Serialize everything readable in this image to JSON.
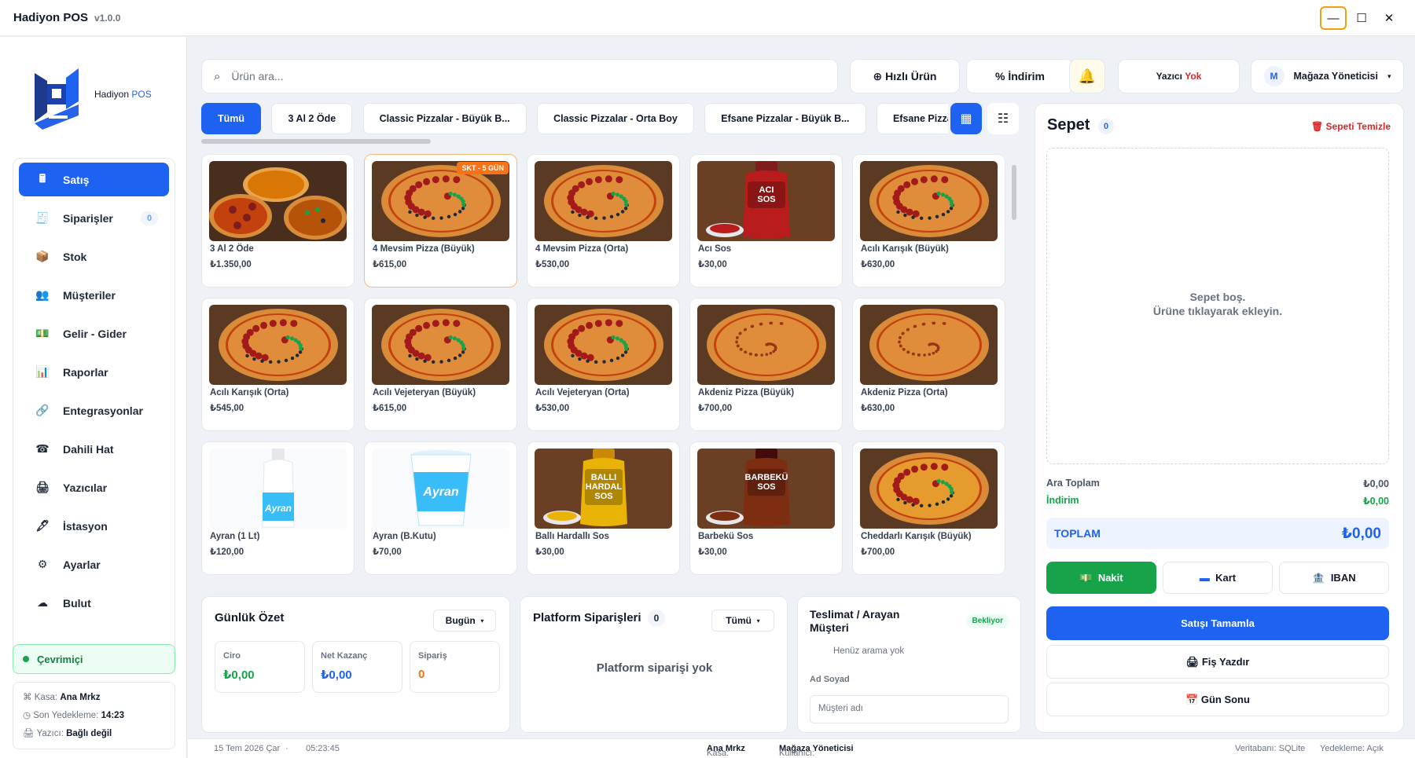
{
  "titlebar": {
    "app_name": "Hadiyon POS",
    "version": "v1.0.0"
  },
  "sidebar": {
    "logo_text": "Hadiyon",
    "logo_text_pos": "POS",
    "items": [
      {
        "label": "Satış",
        "icon": "cash-register-icon",
        "active": true
      },
      {
        "label": "Siparişler",
        "icon": "receipt-icon",
        "count": "0"
      },
      {
        "label": "Stok",
        "icon": "box-icon"
      },
      {
        "label": "Müşteriler",
        "icon": "users-icon"
      },
      {
        "label": "Gelir - Gider",
        "icon": "money-icon"
      },
      {
        "label": "Raporlar",
        "icon": "bar-chart-icon"
      },
      {
        "label": "Entegrasyonlar",
        "icon": "link-icon"
      },
      {
        "label": "Dahili Hat",
        "icon": "phone-icon"
      },
      {
        "label": "Yazıcılar",
        "icon": "printer-icon"
      },
      {
        "label": "İstasyon",
        "icon": "station-icon"
      },
      {
        "label": "Ayarlar",
        "icon": "gear-icon"
      },
      {
        "label": "Bulut",
        "icon": "cloud-icon"
      }
    ],
    "online": "Çevrimiçi",
    "info": {
      "kasa_label": "Kasa:",
      "kasa_value": "Ana Mrkz",
      "backup_label": "Son Yedekleme:",
      "backup_value": "14:23",
      "printer_label": "Yazıcı:",
      "printer_value": "Bağlı değil"
    }
  },
  "topbar": {
    "search_placeholder": "Ürün ara...",
    "quick_product": "⊕ Hızlı Ürün",
    "discount": "% İndirim",
    "printer_label": "Yazıcı",
    "printer_status": "Yok",
    "user_initial": "M",
    "user_name": "Mağaza Yöneticisi"
  },
  "categories": [
    "Tümü",
    "3 Al 2 Öde",
    "Classic Pizzalar - Büyük B...",
    "Classic Pizzalar - Orta Boy",
    "Efsane Pizzalar - Büyük B...",
    "Efsane Pizzal"
  ],
  "products": [
    {
      "name": "3 Al 2 Öde",
      "price": "₺1.350,00",
      "kind": "multi-pizza"
    },
    {
      "name": "4 Mevsim Pizza (Büyük)",
      "price": "₺615,00",
      "kind": "pizza",
      "badge": "SKT - 5 GÜN",
      "selected": true
    },
    {
      "name": "4 Mevsim Pizza (Orta)",
      "price": "₺530,00",
      "kind": "pizza"
    },
    {
      "name": "Acı Sos",
      "price": "₺30,00",
      "kind": "sauce-red",
      "label": "ACI SOS"
    },
    {
      "name": "Acılı Karışık (Büyük)",
      "price": "₺630,00",
      "kind": "pizza"
    },
    {
      "name": "Acılı Karışık (Orta)",
      "price": "₺545,00",
      "kind": "pizza"
    },
    {
      "name": "Acılı Vejeteryan (Büyük)",
      "price": "₺615,00",
      "kind": "pizza"
    },
    {
      "name": "Acılı Vejeteryan (Orta)",
      "price": "₺530,00",
      "kind": "pizza"
    },
    {
      "name": "Akdeniz Pizza (Büyük)",
      "price": "₺700,00",
      "kind": "pizza-plain"
    },
    {
      "name": "Akdeniz Pizza (Orta)",
      "price": "₺630,00",
      "kind": "pizza-plain"
    },
    {
      "name": "Ayran (1 Lt)",
      "price": "₺120,00",
      "kind": "bottle",
      "label": "Ayran"
    },
    {
      "name": "Ayran (B.Kutu)",
      "price": "₺70,00",
      "kind": "cup",
      "label": "Ayran"
    },
    {
      "name": "Ballı Hardallı Sos",
      "price": "₺30,00",
      "kind": "sauce-yellow",
      "label": "BALLI HARDAL SOS"
    },
    {
      "name": "Barbekü Sos",
      "price": "₺30,00",
      "kind": "sauce-bbq",
      "label": "BARBEKÜ SOS"
    },
    {
      "name": "Cheddarlı Karışık (Büyük)",
      "price": "₺700,00",
      "kind": "pizza-cheddar"
    }
  ],
  "summary": {
    "title": "Günlük Özet",
    "period": "Bugün",
    "ciro_label": "Ciro",
    "ciro_value": "₺0,00",
    "net_label": "Net Kazanç",
    "net_value": "₺0,00",
    "order_label": "Sipariş",
    "order_value": "0"
  },
  "platform": {
    "title": "Platform Siparişleri",
    "count": "0",
    "filter": "Tümü",
    "empty": "Platform siparişi yok"
  },
  "caller": {
    "title_line1": "Teslimat / Arayan",
    "title_line2": "Müşteri",
    "status": "Bekliyor",
    "no_call": "Henüz arama yok",
    "name_label": "Ad Soyad",
    "name_placeholder": "Müşteri adı"
  },
  "cart": {
    "title": "Sepet",
    "count": "0",
    "clear": "Sepeti Temizle",
    "empty_line1": "Sepet boş.",
    "empty_line2": "Ürüne tıklayarak ekleyin.",
    "subtotal_label": "Ara Toplam",
    "subtotal_value": "₺0,00",
    "discount_label": "İndirim",
    "discount_value": "₺0,00",
    "total_label": "TOPLAM",
    "total_value": "₺0,00",
    "pay_cash": "Nakit",
    "pay_card": "Kart",
    "pay_iban": "IBAN",
    "complete": "Satışı Tamamla",
    "print_receipt": "Fiş Yazdır",
    "day_end": "Gün Sonu"
  },
  "statusbar": {
    "date": "15 Tem 2026 Çar",
    "time": "05:23:45",
    "kasa_label": "Kasa:",
    "kasa_value": "Ana Mrkz",
    "user_label": "Kullanıcı:",
    "user_value": "Mağaza Yöneticisi",
    "db": "Veritabanı: SQLite",
    "backup": "Yedekleme: Açık"
  },
  "colors": {
    "primary": "#1d62f0",
    "success": "#16a34a",
    "danger": "#dc2626",
    "badge": "#f97316"
  }
}
